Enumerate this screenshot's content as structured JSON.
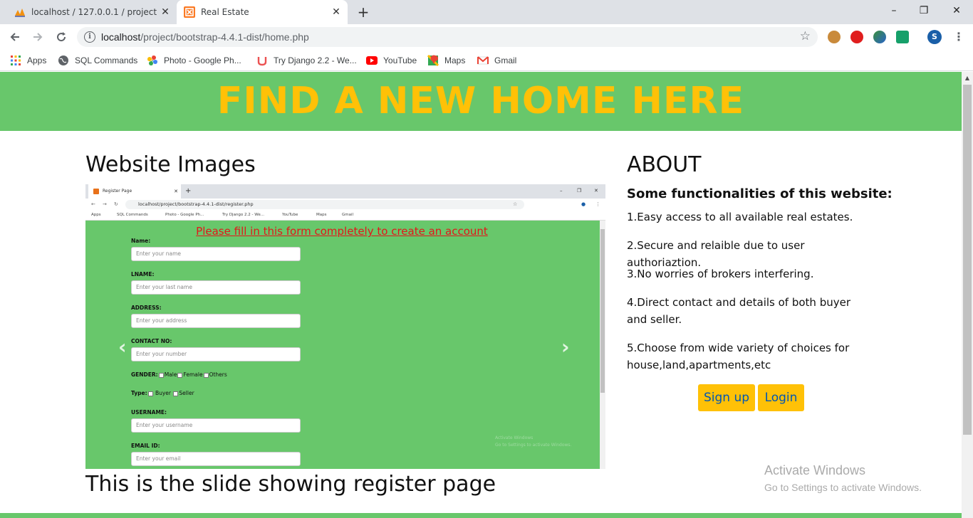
{
  "browser": {
    "tabs": [
      {
        "title": "localhost / 127.0.0.1 / project / p",
        "icon": "phpmyadmin-icon"
      },
      {
        "title": "Real Estate",
        "icon": "xampp-icon"
      }
    ],
    "new_tab": "+",
    "window_controls": {
      "minimize": "–",
      "restore": "❐",
      "close": "✕"
    },
    "url_host": "localhost",
    "url_path": "/project/bootstrap-4.4.1-dist/home.php",
    "profile_initial": "S",
    "bookmarks": [
      {
        "label": "Apps",
        "icon": "apps-grid-icon"
      },
      {
        "label": "SQL Commands",
        "icon": "globe-icon"
      },
      {
        "label": "Photo - Google Ph...",
        "icon": "google-photos-icon"
      },
      {
        "label": "Try Django 2.2 - We...",
        "icon": "udemy-icon"
      },
      {
        "label": "YouTube",
        "icon": "youtube-icon"
      },
      {
        "label": "Maps",
        "icon": "google-maps-icon"
      },
      {
        "label": "Gmail",
        "icon": "gmail-icon"
      }
    ]
  },
  "page": {
    "banner": "FIND A NEW HOME HERE",
    "section_title": "Website Images",
    "caption": "This is the slide showing register page",
    "about": {
      "title": "ABOUT",
      "subtitle": "Some functionalities of this website:",
      "items": [
        "1.Easy access to all available real estates.",
        "2.Secure and relaible due to user authoriaztion.",
        "3.No worries of brokers interfering.",
        "4.Direct contact and details of both buyer and seller.",
        "5.Choose from wide variety of choices for house,land,apartments,etc"
      ]
    },
    "buttons": {
      "signup": "Sign up",
      "login": "Login"
    },
    "activate": {
      "title": "Activate Windows",
      "subtitle": "Go to Settings to activate Windows."
    }
  },
  "slide": {
    "tab_title": "Register Page",
    "url": "localhost/project/bootstrap-4.4.1-dist/register.php",
    "bookmarks": [
      "Apps",
      "SQL Commands",
      "Photo - Google Ph...",
      "Try Django 2.2 - We...",
      "YouTube",
      "Maps",
      "Gmail"
    ],
    "heading": "Please fill in this form completely to create an account",
    "fields": [
      {
        "label": "Name:",
        "placeholder": "Enter your name"
      },
      {
        "label": "LNAME:",
        "placeholder": "Enter your last name"
      },
      {
        "label": "ADDRESS:",
        "placeholder": "Enter your address"
      },
      {
        "label": "CONTACT NO:",
        "placeholder": "Enter your number"
      }
    ],
    "gender": {
      "label": "GENDER:",
      "options": [
        "Male",
        "Female",
        "Others"
      ]
    },
    "type": {
      "label": "Type:",
      "options": [
        "Buyer",
        "Seller"
      ]
    },
    "fields2": [
      {
        "label": "USERNAME:",
        "placeholder": "Enter your username"
      },
      {
        "label": "EMAIL ID:",
        "placeholder": "Enter your email"
      }
    ],
    "watermark": [
      "Activate Windows",
      "Go to Settings to activate Windows."
    ]
  }
}
